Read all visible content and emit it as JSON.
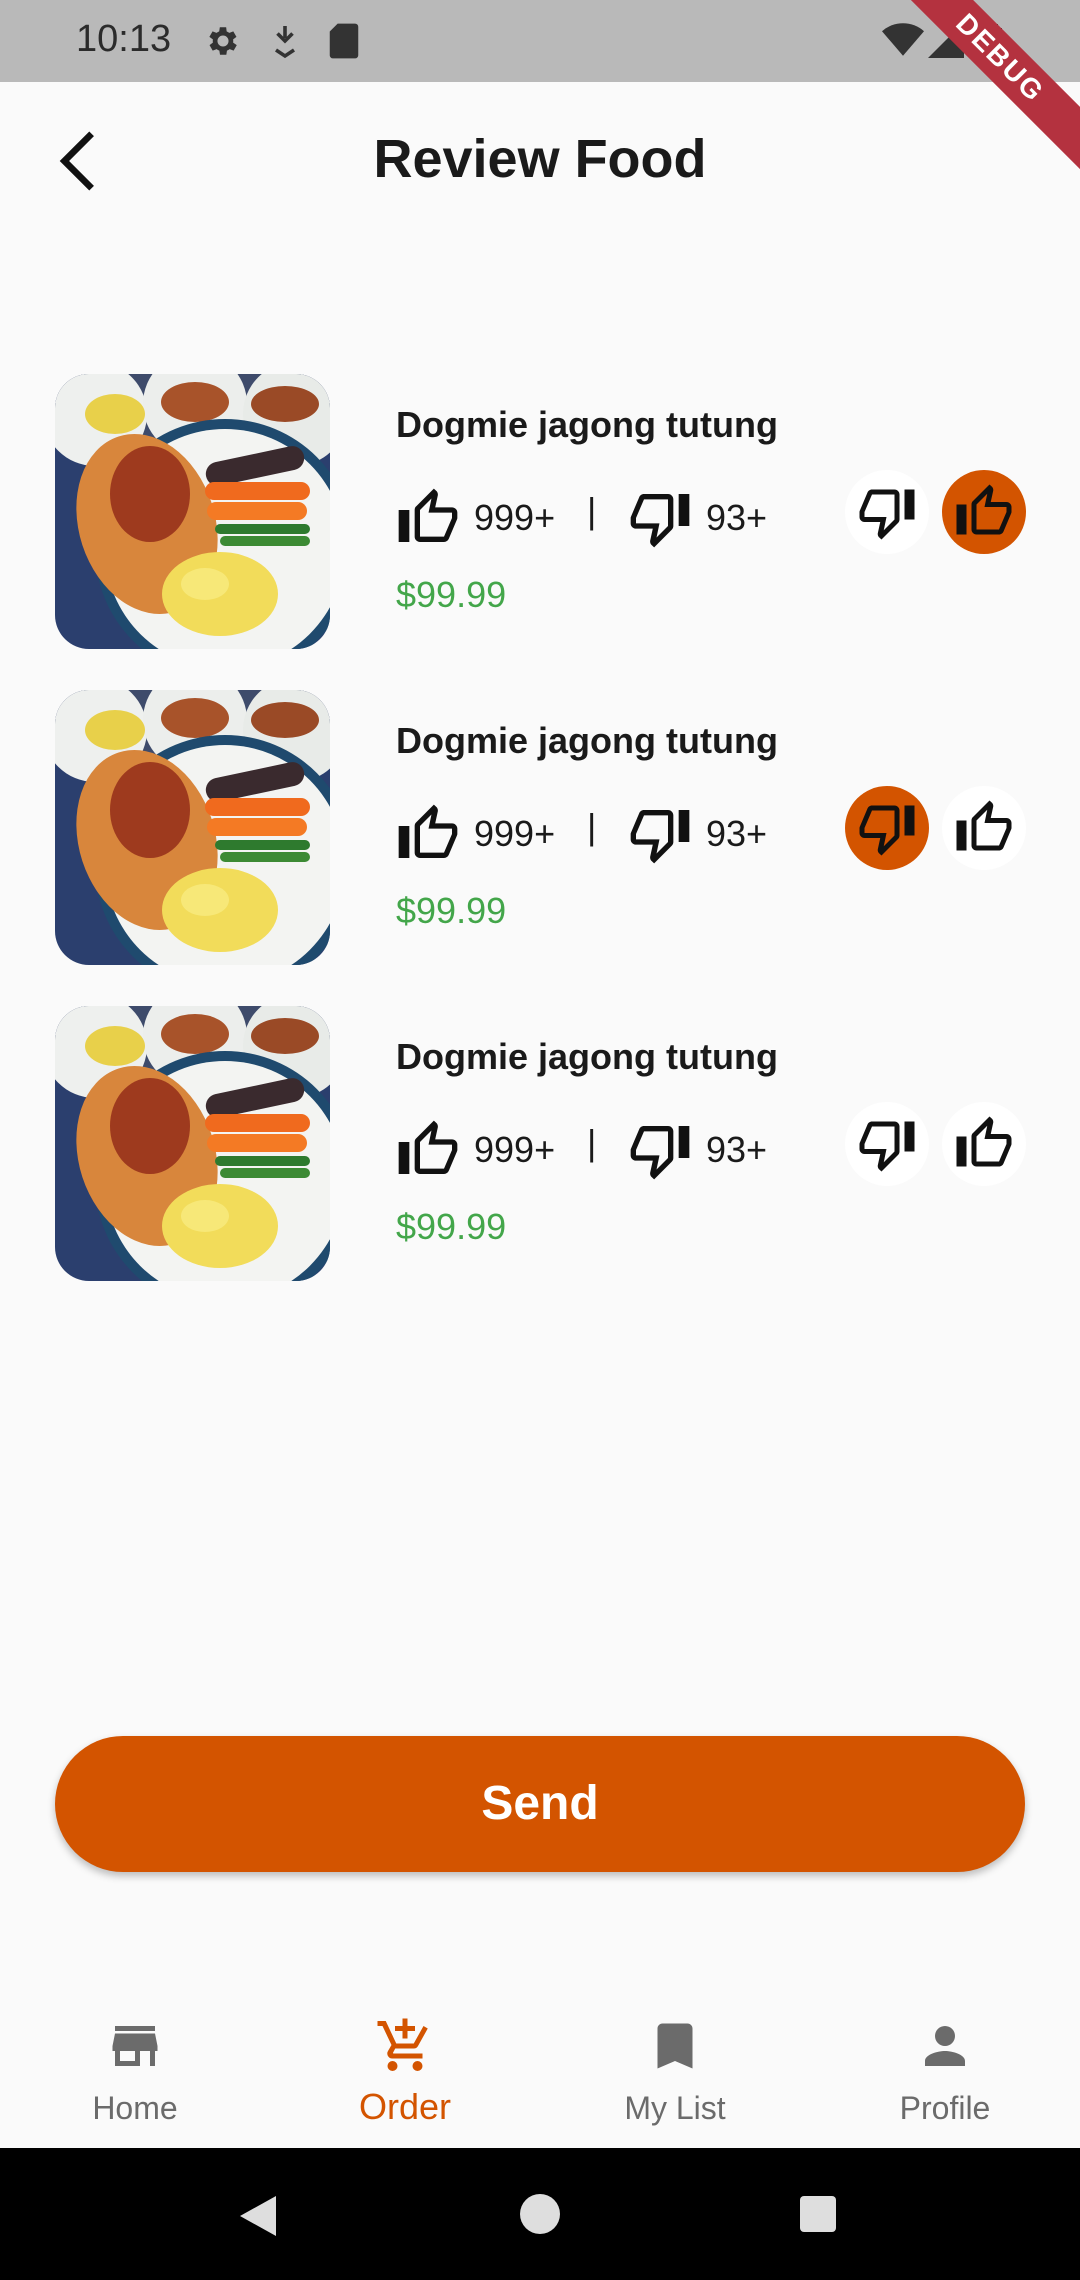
{
  "status_bar": {
    "time": "10:13",
    "debug_label": "DEBUG"
  },
  "header": {
    "title": "Review Food"
  },
  "items": [
    {
      "name": "Dogmie jagong tutung",
      "likes": "999+",
      "separator": "|",
      "dislikes": "93+",
      "price": "$99.99",
      "vote": "like"
    },
    {
      "name": "Dogmie jagong tutung",
      "likes": "999+",
      "separator": "|",
      "dislikes": "93+",
      "price": "$99.99",
      "vote": "dislike"
    },
    {
      "name": "Dogmie jagong tutung",
      "likes": "999+",
      "separator": "|",
      "dislikes": "93+",
      "price": "$99.99",
      "vote": "none"
    }
  ],
  "send_button": {
    "label": "Send"
  },
  "bottom_nav": [
    {
      "label": "Home",
      "icon": "store-icon"
    },
    {
      "label": "Order",
      "icon": "cart-icon",
      "active": true
    },
    {
      "label": "My List",
      "icon": "bookmark-icon"
    },
    {
      "label": "Profile",
      "icon": "person-icon"
    }
  ],
  "colors": {
    "accent": "#d35400",
    "price": "#43a64a",
    "status_bar": "#b9b9b9"
  }
}
